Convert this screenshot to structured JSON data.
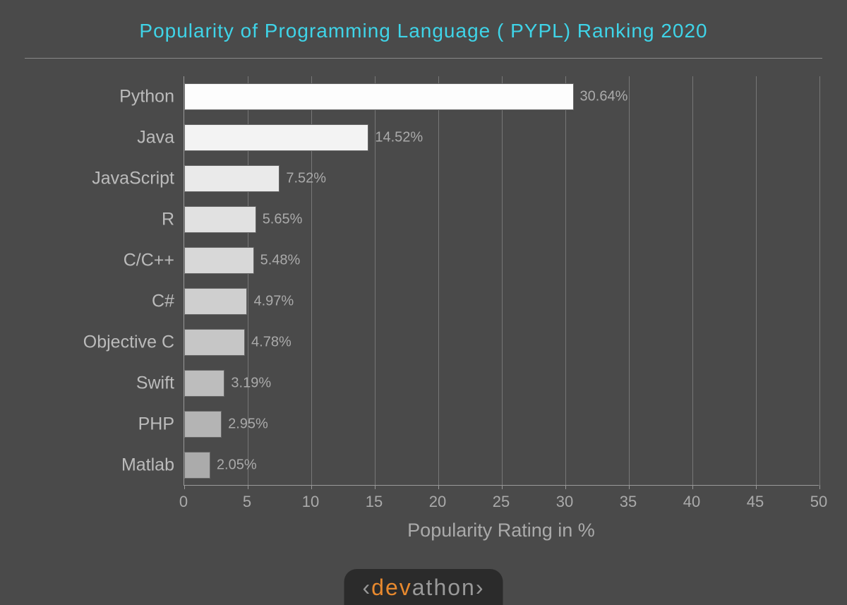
{
  "title": "Popularity of Programming Language ( PYPL) Ranking 2020",
  "xlabel": "Popularity Rating in %",
  "logo": {
    "left": "dev",
    "right": "athon"
  },
  "chart_data": {
    "type": "bar",
    "orientation": "horizontal",
    "title": "Popularity of Programming Language ( PYPL) Ranking 2020",
    "xlabel": "Popularity Rating in %",
    "ylabel": "",
    "xlim": [
      0,
      50
    ],
    "xticks": [
      0,
      5,
      10,
      15,
      20,
      25,
      30,
      35,
      40,
      45,
      50
    ],
    "categories": [
      "Python",
      "Java",
      "JavaScript",
      "R",
      "C/C++",
      "C#",
      "Objective C",
      "Swift",
      "PHP",
      "Matlab"
    ],
    "values": [
      30.64,
      14.52,
      7.52,
      5.65,
      5.48,
      4.97,
      4.78,
      3.19,
      2.95,
      2.05
    ],
    "value_suffix": "%",
    "bar_colors": [
      "#fdfdfd",
      "#f3f3f3",
      "#eaeaea",
      "#e1e1e1",
      "#d8d8d8",
      "#cfcfcf",
      "#c6c6c6",
      "#bdbdbd",
      "#b4b4b4",
      "#ababab"
    ]
  }
}
